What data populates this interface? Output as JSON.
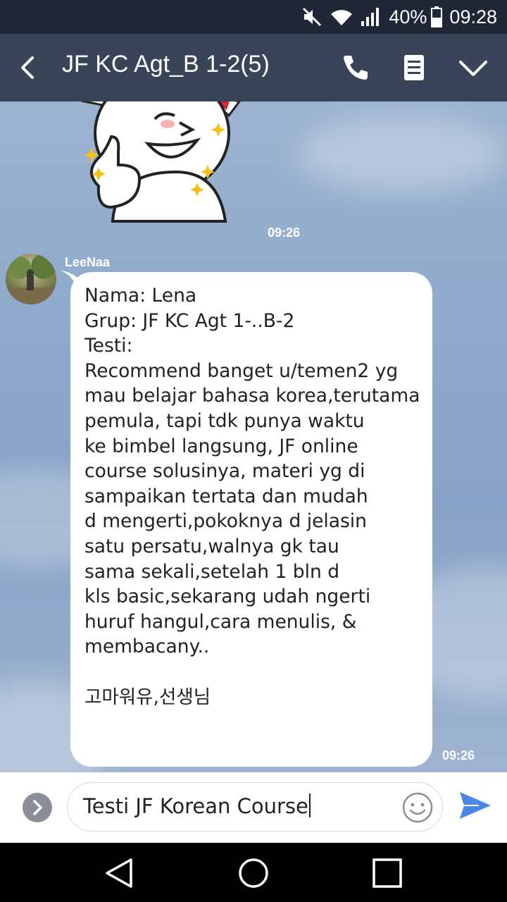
{
  "status_bar": {
    "icons": [
      "mute-icon",
      "wifi-icon",
      "signal-icon",
      "battery-icon"
    ],
    "battery": "40%",
    "time": "09:28"
  },
  "header": {
    "title": "JF KC Agt_B 1-2(5)",
    "icons": [
      "back-icon",
      "phone-icon",
      "notes-icon",
      "chevron-down-icon"
    ]
  },
  "chat": {
    "sticker_time": "09:26",
    "message": {
      "sender": "LeeNaa",
      "time": "09:26",
      "lines": [
        "Nama: Lena",
        "Grup: JF KC Agt 1-..B-2",
        "Testi:",
        "Recommend banget u/temen2 yg",
        "mau belajar bahasa korea,terutama",
        "pemula, tapi tdk punya waktu",
        "ke bimbel langsung, JF online",
        "course solusinya, materi yg di",
        "sampaikan tertata dan mudah",
        "d mengerti,pokoknya d jelasin",
        "satu persatu,walnya gk tau",
        "sama sekali,setelah 1 bln d",
        "kls basic,sekarang udah ngerti",
        "huruf hangul,cara menulis, &",
        "membacany..",
        "",
        "고마워유,선생님"
      ]
    }
  },
  "input": {
    "value": "Testi JF Korean Course",
    "icons": [
      "expand-icon",
      "emoji-icon",
      "send-icon"
    ],
    "accent": "#4a86e8"
  },
  "nav": {
    "icons": [
      "back-triangle-icon",
      "home-circle-icon",
      "recents-square-icon"
    ]
  },
  "colors": {
    "status_bg": "#1f2736",
    "header_bg": "#3a4458",
    "bubble": "#ffffff"
  }
}
